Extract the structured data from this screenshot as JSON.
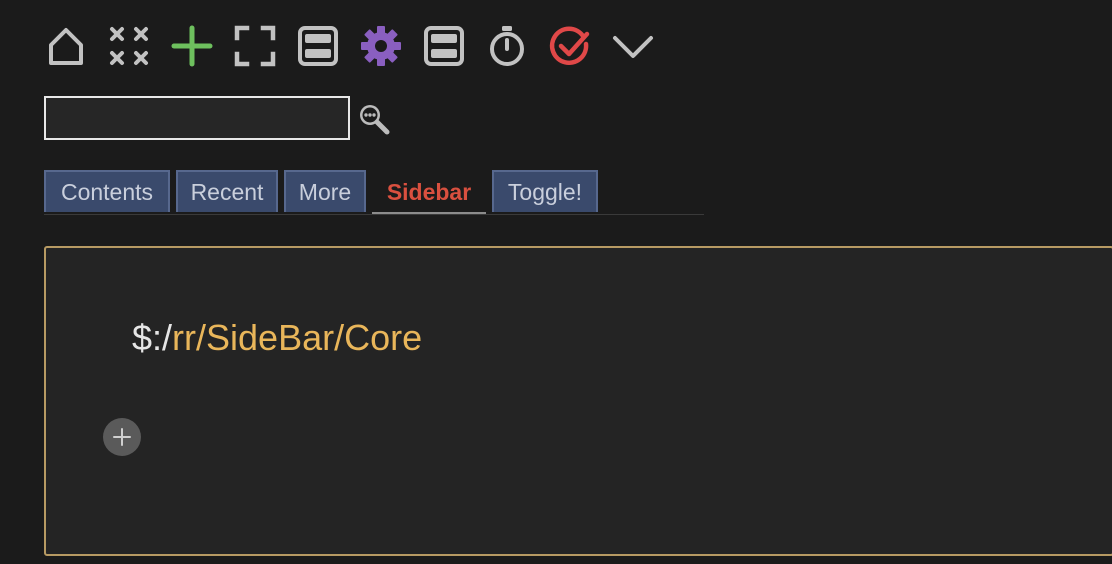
{
  "toolbar": {
    "buttons": [
      {
        "icon": "home-icon",
        "color": "#c2c2c2"
      },
      {
        "icon": "close-all-icon",
        "color": "#c2c2c2"
      },
      {
        "icon": "new-tiddler-icon",
        "color": "#6ec05e"
      },
      {
        "icon": "full-screen-icon",
        "color": "#c2c2c2"
      },
      {
        "icon": "layout-icon",
        "color": "#c2c2c2"
      },
      {
        "icon": "gear-icon",
        "color": "#8a5fc0"
      },
      {
        "icon": "storyview-icon",
        "color": "#c2c2c2"
      },
      {
        "icon": "timer-icon",
        "color": "#c2c2c2"
      },
      {
        "icon": "check-circle-icon",
        "color": "#e04848"
      },
      {
        "icon": "chevron-down-icon",
        "color": "#c2c2c2"
      }
    ]
  },
  "search": {
    "value": "",
    "placeholder": "",
    "advanced_icon": "advanced-search-icon"
  },
  "tabs": [
    {
      "label": "Contents",
      "active": false
    },
    {
      "label": "Recent",
      "active": false
    },
    {
      "label": "More",
      "active": false
    },
    {
      "label": "Sidebar",
      "active": true
    },
    {
      "label": "Toggle!",
      "active": false
    }
  ],
  "panel": {
    "path_prefix": "$:/",
    "path_link": "rr/SideBar/Core",
    "add_icon": "plus-icon"
  },
  "colors": {
    "background": "#1b1b1b",
    "panel_border": "#b79a63",
    "link": "#e9b65a",
    "active_tab": "#d9503f",
    "tab_bg": "#3a4a6c"
  }
}
